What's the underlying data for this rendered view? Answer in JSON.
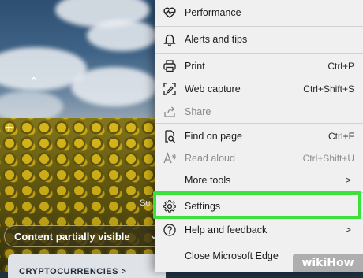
{
  "background": {
    "partial_label": "Su",
    "content_pill": "Content partially visible",
    "card_label": "CRYPTOCURRENCIES >"
  },
  "menu": {
    "items": [
      {
        "label": "Performance",
        "icon": "heartbeat-icon"
      },
      {
        "label": "Alerts and tips",
        "icon": "bell-icon"
      },
      {
        "label": "Print",
        "shortcut": "Ctrl+P",
        "icon": "printer-icon"
      },
      {
        "label": "Web capture",
        "shortcut": "Ctrl+Shift+S",
        "icon": "web-capture-icon"
      },
      {
        "label": "Share",
        "icon": "share-icon",
        "disabled": true
      },
      {
        "label": "Find on page",
        "shortcut": "Ctrl+F",
        "icon": "find-icon"
      },
      {
        "label": "Read aloud",
        "shortcut": "Ctrl+Shift+U",
        "icon": "read-aloud-icon",
        "disabled": true
      },
      {
        "label": "More tools",
        "icon": "none",
        "submenu": true
      },
      {
        "label": "Settings",
        "icon": "gear-icon",
        "highlighted": true
      },
      {
        "label": "Help and feedback",
        "icon": "help-icon",
        "submenu": true
      },
      {
        "label": "Close Microsoft Edge",
        "icon": "none"
      }
    ],
    "arrow_glyph": ">",
    "highlight_color": "#3ce13c"
  },
  "watermark": {
    "wiki": "wiki",
    "how": "How"
  }
}
